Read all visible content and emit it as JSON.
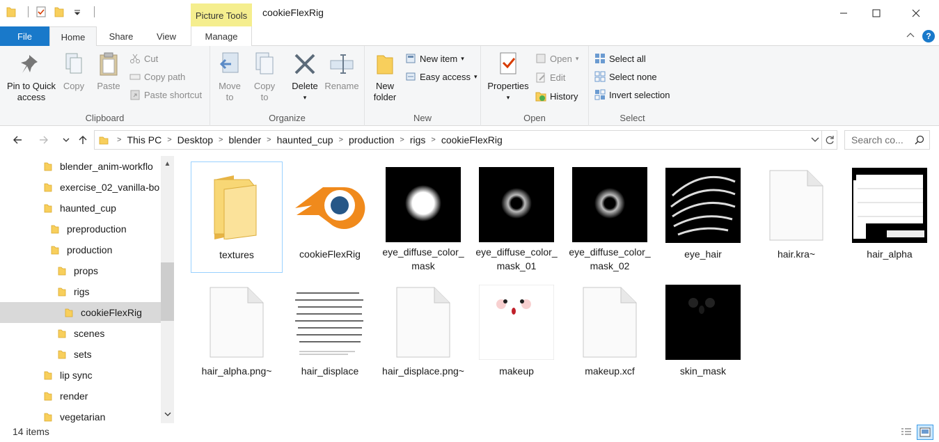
{
  "window": {
    "title": "cookieFlexRig",
    "context_tab": "Picture Tools",
    "colors": {
      "file_tab": "#1979ca",
      "picture_tools": "#f5ee8e",
      "folder": "#f8cf5c",
      "selected": "#d9d9d9"
    }
  },
  "tabs": [
    "File",
    "Home",
    "Share",
    "View",
    "Manage"
  ],
  "ribbon": {
    "clipboard": {
      "label": "Clipboard",
      "pin": "Pin to Quick access",
      "copy": "Copy",
      "paste": "Paste",
      "cut": "Cut",
      "copy_path": "Copy path",
      "paste_shortcut": "Paste shortcut"
    },
    "organize": {
      "label": "Organize",
      "move_to": "Move to",
      "copy_to": "Copy to",
      "delete": "Delete",
      "rename": "Rename"
    },
    "new": {
      "label": "New",
      "new_folder": "New folder",
      "new_item": "New item",
      "easy_access": "Easy access"
    },
    "open": {
      "label": "Open",
      "properties": "Properties",
      "open": "Open",
      "edit": "Edit",
      "history": "History"
    },
    "select": {
      "label": "Select",
      "select_all": "Select all",
      "select_none": "Select none",
      "invert": "Invert selection"
    }
  },
  "address": {
    "crumbs": [
      "This PC",
      "Desktop",
      "blender",
      "haunted_cup",
      "production",
      "rigs",
      "cookieFlexRig"
    ]
  },
  "search": {
    "placeholder": "Search co..."
  },
  "nav": [
    {
      "label": "blender_anim-workflo",
      "indent": 0
    },
    {
      "label": "exercise_02_vanilla-bo",
      "indent": 0
    },
    {
      "label": "haunted_cup",
      "indent": 0
    },
    {
      "label": "preproduction",
      "indent": 1
    },
    {
      "label": "production",
      "indent": 1
    },
    {
      "label": "props",
      "indent": 2
    },
    {
      "label": "rigs",
      "indent": 2
    },
    {
      "label": "cookieFlexRig",
      "indent": 3,
      "selected": true
    },
    {
      "label": "scenes",
      "indent": 2
    },
    {
      "label": "sets",
      "indent": 2
    },
    {
      "label": "lip sync",
      "indent": 0
    },
    {
      "label": "render",
      "indent": 0
    },
    {
      "label": "vegetarian",
      "indent": 0
    }
  ],
  "files": [
    {
      "name": "textures",
      "kind": "folder-icon"
    },
    {
      "name": "cookieFlexRig",
      "kind": "blender-icon"
    },
    {
      "name": "eye_diffuse_color_mask",
      "kind": "soft-dot-thumbnail"
    },
    {
      "name": "eye_diffuse_color_mask_01",
      "kind": "iris-thumbnail"
    },
    {
      "name": "eye_diffuse_color_mask_02",
      "kind": "iris-thumbnail"
    },
    {
      "name": "eye_hair",
      "kind": "hair-strands-thumbnail"
    },
    {
      "name": "hair.kra~",
      "kind": "blank-file-icon"
    },
    {
      "name": "hair_alpha",
      "kind": "hair-alpha-thumbnail"
    },
    {
      "name": "hair_alpha.png~",
      "kind": "blank-file-icon"
    },
    {
      "name": "hair_displace",
      "kind": "hair-displace-thumbnail"
    },
    {
      "name": "hair_displace.png~",
      "kind": "blank-file-icon"
    },
    {
      "name": "makeup",
      "kind": "makeup-thumbnail"
    },
    {
      "name": "makeup.xcf",
      "kind": "blank-file-icon"
    },
    {
      "name": "skin_mask",
      "kind": "skin-mask-thumbnail"
    }
  ],
  "status": {
    "count": "14 items"
  }
}
